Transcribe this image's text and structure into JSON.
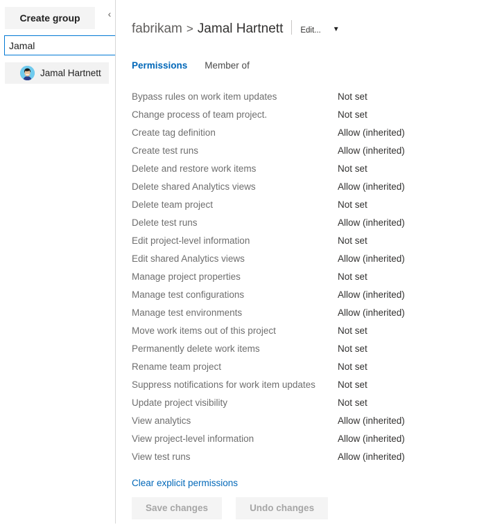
{
  "sidebar": {
    "create_group_label": "Create group",
    "collapse_icon": "chevron-left-icon",
    "search": {
      "value": "Jamal",
      "placeholder": "Search users or groups"
    },
    "members": [
      {
        "name": "Jamal Hartnett"
      }
    ]
  },
  "header": {
    "breadcrumb_org": "fabrikam",
    "breadcrumb_separator": ">",
    "breadcrumb_current": "Jamal Hartnett",
    "edit_label": "Edit...",
    "edit_caret_icon": "chevron-down-icon",
    "avatar_name": "avatar"
  },
  "tabs": [
    {
      "label": "Permissions",
      "active": true
    },
    {
      "label": "Member of",
      "active": false
    }
  ],
  "permissions": {
    "rows": [
      {
        "label": "Bypass rules on work item updates",
        "value": "Not set"
      },
      {
        "label": "Change process of team project.",
        "value": "Not set"
      },
      {
        "label": "Create tag definition",
        "value": "Allow (inherited)"
      },
      {
        "label": "Create test runs",
        "value": "Allow (inherited)"
      },
      {
        "label": "Delete and restore work items",
        "value": "Not set"
      },
      {
        "label": "Delete shared Analytics views",
        "value": "Allow (inherited)"
      },
      {
        "label": "Delete team project",
        "value": "Not set"
      },
      {
        "label": "Delete test runs",
        "value": "Allow (inherited)"
      },
      {
        "label": "Edit project-level information",
        "value": "Not set"
      },
      {
        "label": "Edit shared Analytics views",
        "value": "Allow (inherited)"
      },
      {
        "label": "Manage project properties",
        "value": "Not set"
      },
      {
        "label": "Manage test configurations",
        "value": "Allow (inherited)"
      },
      {
        "label": "Manage test environments",
        "value": "Allow (inherited)"
      },
      {
        "label": "Move work items out of this project",
        "value": "Not set"
      },
      {
        "label": "Permanently delete work items",
        "value": "Not set"
      },
      {
        "label": "Rename team project",
        "value": "Not set"
      },
      {
        "label": "Suppress notifications for work item updates",
        "value": "Not set"
      },
      {
        "label": "Update project visibility",
        "value": "Not set"
      },
      {
        "label": "View analytics",
        "value": "Allow (inherited)"
      },
      {
        "label": "View project-level information",
        "value": "Allow (inherited)"
      },
      {
        "label": "View test runs",
        "value": "Allow (inherited)"
      }
    ]
  },
  "footer": {
    "clear_link_label": "Clear explicit permissions",
    "save_label": "Save changes",
    "undo_label": "Undo changes"
  },
  "colors": {
    "accent_blue": "#0067b8",
    "focus_blue": "#0078d4",
    "button_gray": "#f4f4f4",
    "label_gray": "#6e6e6e",
    "value_dark": "#323130",
    "avatar_bg": "#6fcbee",
    "avatar_hair": "#1a1a1a",
    "avatar_skin": "#e8c39e",
    "avatar_shirt": "#2a3f8f"
  }
}
